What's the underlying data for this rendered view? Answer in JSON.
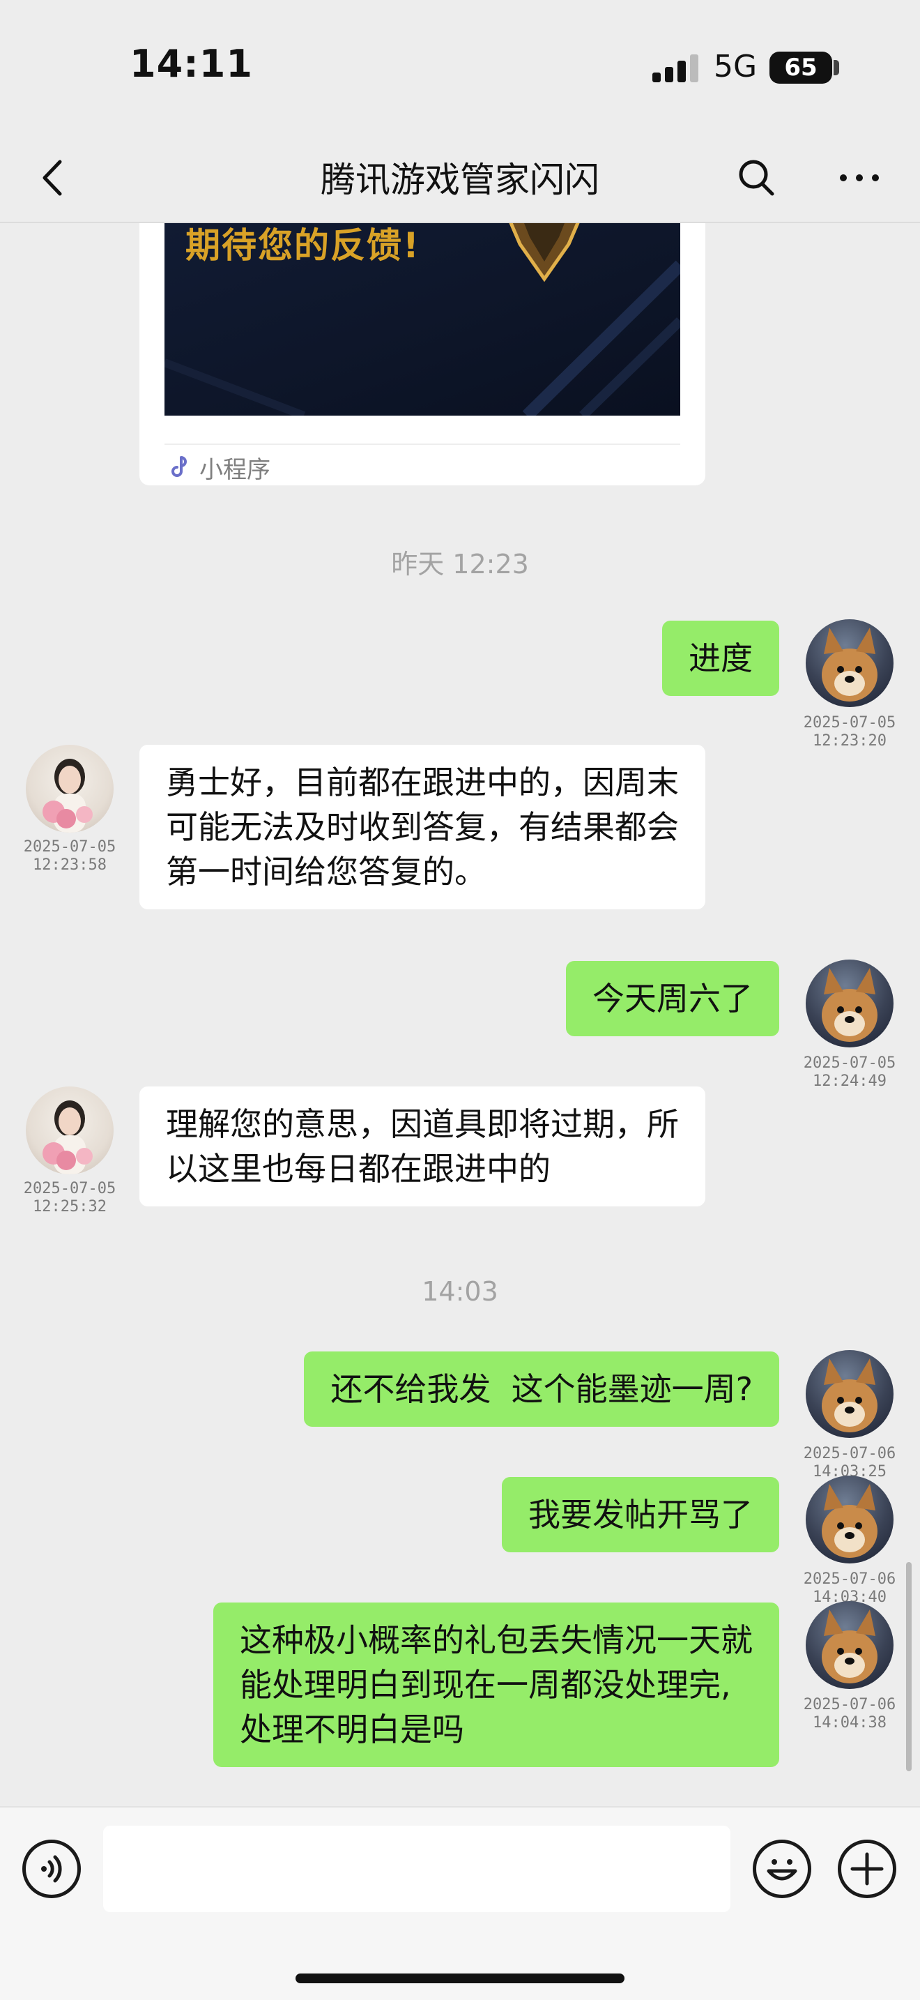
{
  "status_bar": {
    "time": "14:11",
    "network": "5G",
    "battery": "65"
  },
  "header": {
    "title": "腾讯游戏管家闪闪"
  },
  "mini_program_card": {
    "headline": "期待您的反馈!",
    "label": "小程序"
  },
  "messages": {
    "sep1": "昨天 12:23",
    "m1": {
      "text": "进度",
      "date": "2025-07-05",
      "time": "12:23:20"
    },
    "m2": {
      "lines": [
        "勇士好，目前都在跟进中的，因周末",
        "可能无法及时收到答复，有结果都会",
        "第一时间给您答复的。"
      ],
      "date": "2025-07-05",
      "time": "12:23:58"
    },
    "m3": {
      "text": "今天周六了",
      "date": "2025-07-05",
      "time": "12:24:49"
    },
    "m4": {
      "lines": [
        "理解您的意思，因道具即将过期，所",
        "以这里也每日都在跟进中的"
      ],
      "date": "2025-07-05",
      "time": "12:25:32"
    },
    "sep2": "14:03",
    "m5": {
      "text": "还不给我发  这个能墨迹一周?",
      "date": "2025-07-06",
      "time": "14:03:25"
    },
    "m6": {
      "text": "我要发帖开骂了",
      "date": "2025-07-06",
      "time": "14:03:40"
    },
    "m7": {
      "lines": [
        "这种极小概率的礼包丢失情况一天就",
        "能处理明白到现在一周都没处理完,",
        "处理不明白是吗"
      ],
      "date": "2025-07-06",
      "time": "14:04:38"
    }
  },
  "icons": {
    "back": "chevron-left-icon",
    "search": "search-icon",
    "more": "more-icon",
    "voice": "voice-icon",
    "emoji": "emoji-icon",
    "plus": "plus-icon",
    "mini_program": "mini-program-icon"
  },
  "colors": {
    "sent_bubble": "#95ec69",
    "received_bubble": "#ffffff",
    "background": "#ededed"
  }
}
